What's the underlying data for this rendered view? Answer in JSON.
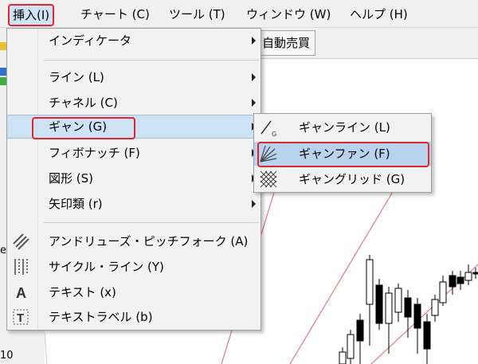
{
  "menubar": {
    "items": [
      {
        "label": "挿入(I)",
        "active": true
      },
      {
        "label": "チャート (C)",
        "active": false
      },
      {
        "label": "ツール (T)",
        "active": false
      },
      {
        "label": "ウィンドウ (W)",
        "active": false
      },
      {
        "label": "ヘルプ (H)",
        "active": false
      }
    ]
  },
  "toolbar": {
    "auto_trade_label": "自動売買"
  },
  "background": {
    "left_edge_letter": "e",
    "left_edge_value": "10"
  },
  "insert_menu": {
    "items": [
      {
        "label": "インディケータ",
        "submenu": true,
        "icon": ""
      },
      {
        "label": "ライン (L)",
        "submenu": true,
        "icon": ""
      },
      {
        "label": "チャネル (C)",
        "submenu": true,
        "icon": ""
      },
      {
        "label": "ギャン (G)",
        "submenu": true,
        "icon": "",
        "highlighted": true
      },
      {
        "label": "フィボナッチ (F)",
        "submenu": true,
        "icon": ""
      },
      {
        "label": "図形 (S)",
        "submenu": true,
        "icon": ""
      },
      {
        "label": "矢印類 (r)",
        "submenu": true,
        "icon": ""
      },
      {
        "label": "アンドリューズ・ピッチフォーク (A)",
        "submenu": false,
        "icon": "pitchfork-icon"
      },
      {
        "label": "サイクル・ライン (Y)",
        "submenu": false,
        "icon": "cycle-lines-icon"
      },
      {
        "label": "テキスト (x)",
        "submenu": false,
        "icon": "text-icon"
      },
      {
        "label": "テキストラベル (b)",
        "submenu": false,
        "icon": "text-label-icon"
      }
    ]
  },
  "gann_submenu": {
    "items": [
      {
        "label": "ギャンライン (L)",
        "icon": "gann-line-icon"
      },
      {
        "label": "ギャンファン (F)",
        "icon": "gann-fan-icon",
        "highlighted": true
      },
      {
        "label": "ギャングリッド (G)",
        "icon": "gann-grid-icon"
      }
    ]
  },
  "colors": {
    "highlight_box": "#e3242b",
    "selection_fill": "#cde2f5",
    "chart_line": "#e06070"
  }
}
